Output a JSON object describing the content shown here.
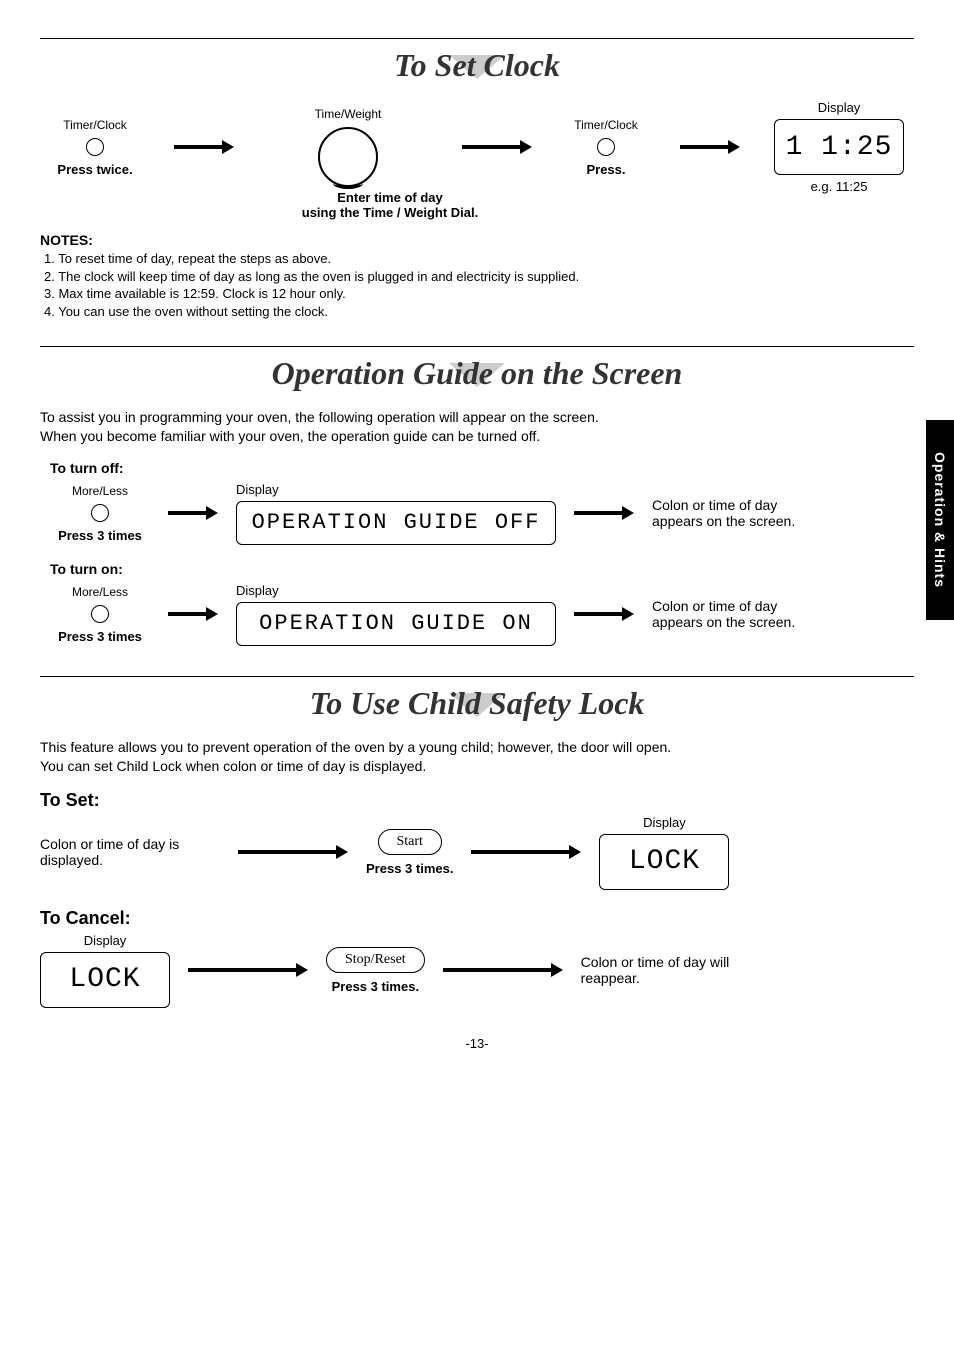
{
  "sideTab": "Operation & Hints",
  "sec1": {
    "title": "To Set Clock",
    "step1": {
      "label": "Timer/Clock",
      "action": "Press twice."
    },
    "step2": {
      "label": "Time/Weight",
      "caption": "Enter time of day\nusing the Time / Weight Dial."
    },
    "step3": {
      "label": "Timer/Clock",
      "action": "Press."
    },
    "display": {
      "label": "Display",
      "value": "1 1:25",
      "caption": "e.g. 11:25"
    },
    "notesTitle": "NOTES:",
    "notes": [
      "1.  To reset time of day, repeat the steps as above.",
      "2.  The clock will keep time of day as long as the oven is plugged in and electricity is supplied.",
      "3.  Max time available is 12:59. Clock is 12 hour only.",
      "4.  You can use the oven without setting the clock."
    ]
  },
  "sec2": {
    "title": "Operation Guide on the Screen",
    "intro": "To assist you in programming your oven, the following operation will appear on the screen.\nWhen you become familiar with your oven, the operation guide can be turned off.",
    "off": {
      "header": "To turn off:",
      "btnLabel": "More/Less",
      "btnAction": "Press 3 times",
      "displayLabel": "Display",
      "displayText": "OPERATION GUIDE OFF",
      "result": "Colon or time of day appears on the screen."
    },
    "on": {
      "header": "To turn on:",
      "btnLabel": "More/Less",
      "btnAction": "Press 3 times",
      "displayLabel": "Display",
      "displayText": "OPERATION GUIDE ON",
      "result": "Colon or time of day appears on the screen."
    }
  },
  "sec3": {
    "title": "To Use Child Safety Lock",
    "intro": "This feature allows you to prevent operation of the oven by a young child; however, the door will open.\nYou can set Child Lock when colon or time of day is displayed.",
    "set": {
      "header": "To Set:",
      "precond": "Colon or time of day is displayed.",
      "btn": "Start",
      "btnAction": "Press 3 times.",
      "displayLabel": "Display",
      "displayText": "LOCK"
    },
    "cancel": {
      "header": "To Cancel:",
      "displayLabel": "Display",
      "displayText": "LOCK",
      "btn": "Stop/Reset",
      "btnAction": "Press 3 times.",
      "result": "Colon or time of day will reappear."
    }
  },
  "pageNumber": "-13-"
}
